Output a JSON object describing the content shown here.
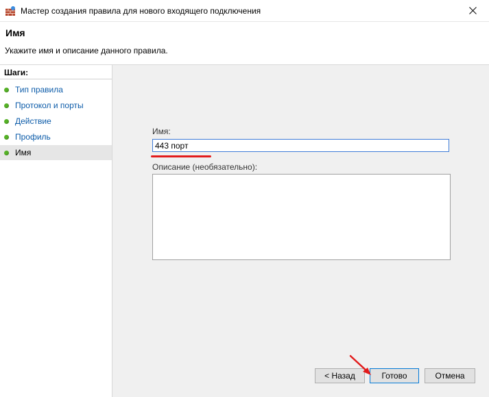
{
  "window": {
    "title": "Мастер создания правила для нового входящего подключения",
    "icon": "firewall-icon",
    "close_icon": "close-icon"
  },
  "header": {
    "title": "Имя",
    "description": "Укажите имя и описание данного правила."
  },
  "steps": {
    "title": "Шаги:",
    "items": [
      {
        "label": "Тип правила",
        "active": false
      },
      {
        "label": "Протокол и порты",
        "active": false
      },
      {
        "label": "Действие",
        "active": false
      },
      {
        "label": "Профиль",
        "active": false
      },
      {
        "label": "Имя",
        "active": true
      }
    ],
    "bullet_color": "#55b226"
  },
  "form": {
    "name_label": "Имя:",
    "name_value": "443 порт",
    "description_label": "Описание (необязательно):",
    "description_value": ""
  },
  "buttons": {
    "back": "< Назад",
    "finish": "Готово",
    "cancel": "Отмена"
  },
  "annotations": {
    "highlight_color": "#e21b1b"
  }
}
